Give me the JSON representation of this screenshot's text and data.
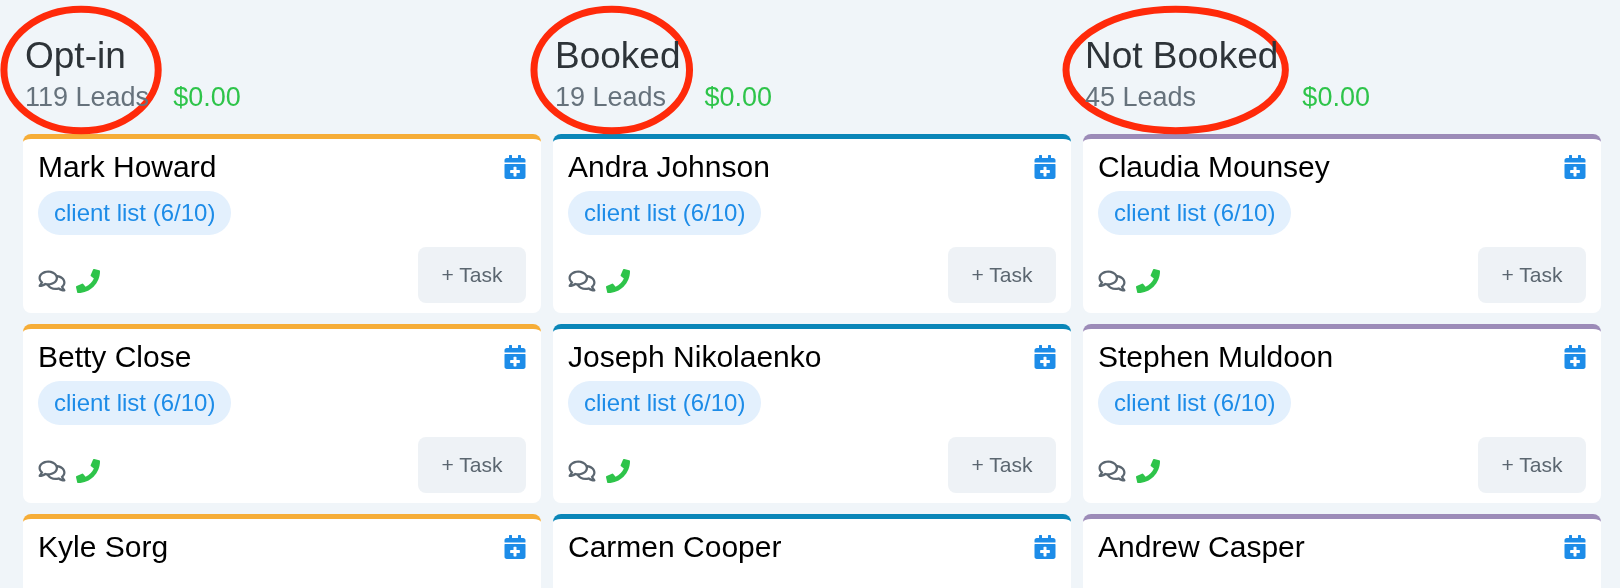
{
  "columns": [
    {
      "title": "Opt-in",
      "leads": "119 Leads",
      "amount": "$0.00",
      "color": "#f6ad37",
      "circled": true,
      "cards": [
        {
          "name": "Mark Howard",
          "tag": "client list (6/10)",
          "task": "+ Task"
        },
        {
          "name": "Betty Close",
          "tag": "client list (6/10)",
          "task": "+ Task"
        },
        {
          "name": "Kyle Sorg"
        }
      ]
    },
    {
      "title": "Booked",
      "leads": "19 Leads",
      "amount": "$0.00",
      "color": "#0a86b8",
      "circled": true,
      "cards": [
        {
          "name": "Andra Johnson",
          "tag": "client list (6/10)",
          "task": "+ Task"
        },
        {
          "name": "Joseph Nikolaenko",
          "tag": "client list (6/10)",
          "task": "+ Task"
        },
        {
          "name": "Carmen Cooper"
        }
      ]
    },
    {
      "title": "Not Booked",
      "leads": "45 Leads",
      "amount": "$0.00",
      "color": "#9c8bb8",
      "circled": true,
      "cards": [
        {
          "name": "Claudia Mounsey",
          "tag": "client list (6/10)",
          "task": "+ Task"
        },
        {
          "name": "Stephen Muldoon",
          "tag": "client list (6/10)",
          "task": "+ Task"
        },
        {
          "name": "Andrew Casper"
        }
      ]
    }
  ]
}
